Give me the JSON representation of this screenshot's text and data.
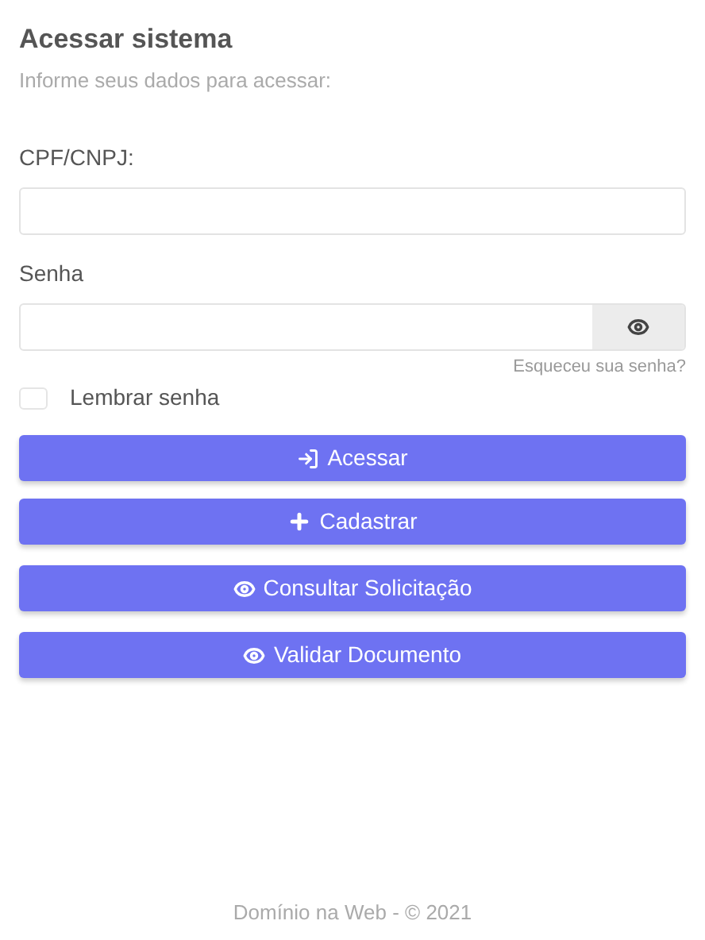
{
  "title": "Acessar sistema",
  "subtitle": "Informe seus dados para acessar:",
  "fields": [
    {
      "label": "CPF/CNPJ:",
      "kind": "text"
    },
    {
      "label": "Senha",
      "kind": "password"
    }
  ],
  "forgot_link": "Esqueceu sua senha?",
  "remember": {
    "label": "Lembrar senha",
    "checked": false
  },
  "buttons": [
    {
      "label": "Acessar",
      "kind": "login"
    },
    {
      "label": "Cadastrar",
      "kind": "plus"
    },
    {
      "label": "Consultar Solicitação",
      "kind": "eye"
    },
    {
      "label": "Validar Documento",
      "kind": "eye"
    }
  ],
  "footer": "Domínio na Web - © 2021"
}
